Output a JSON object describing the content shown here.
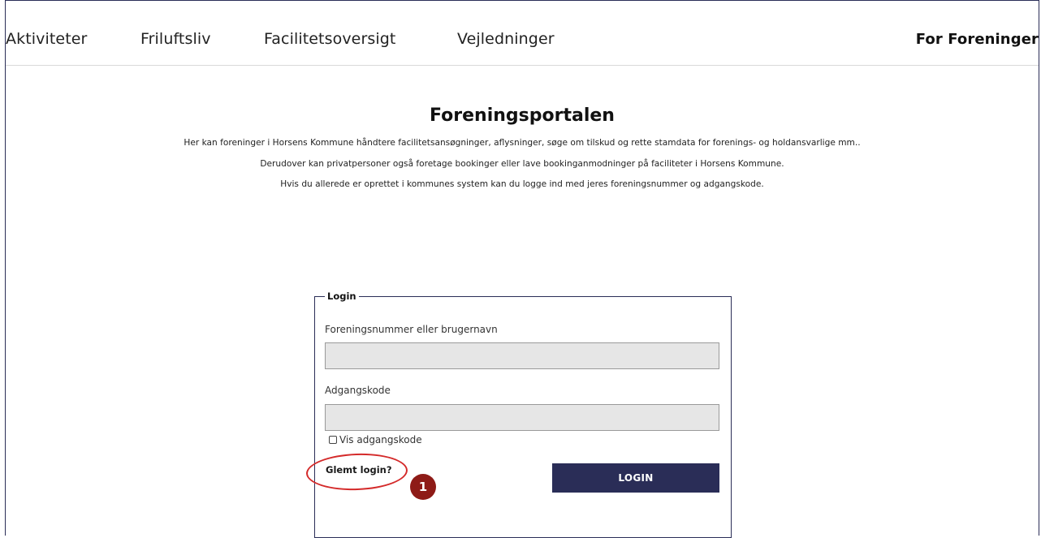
{
  "nav": {
    "items": [
      "Aktiviteter",
      "Friluftsliv",
      "Facilitetsoversigt",
      "Vejledninger"
    ],
    "active": "For Foreninger"
  },
  "main": {
    "title": "Foreningsportalen",
    "intro_lines": [
      "Her kan foreninger i Horsens Kommune håndtere facilitetsansøgninger, aflysninger, søge om tilskud og rette stamdata for forenings- og holdansvarlige mm..",
      "Derudover kan privatpersoner også foretage bookinger eller lave bookinganmodninger på faciliteter i Horsens Kommune.",
      "Hvis du allerede er oprettet i kommunes system kan du logge ind med jeres foreningsnummer og adgangskode."
    ]
  },
  "login": {
    "legend": "Login",
    "username_label": "Foreningsnummer eller brugernavn",
    "username_value": "",
    "password_label": "Adgangskode",
    "password_value": "",
    "show_password_label": "Vis adgangskode",
    "show_password_checked": false,
    "forgot_label": "Glemt login?",
    "submit_label": "LOGIN"
  },
  "annotation": {
    "step_number": "1",
    "highlight_color": "#d42a2a",
    "badge_color": "#8e1b17"
  },
  "colors": {
    "brand_navy": "#2a2d57",
    "input_bg": "#e6e6e6"
  }
}
